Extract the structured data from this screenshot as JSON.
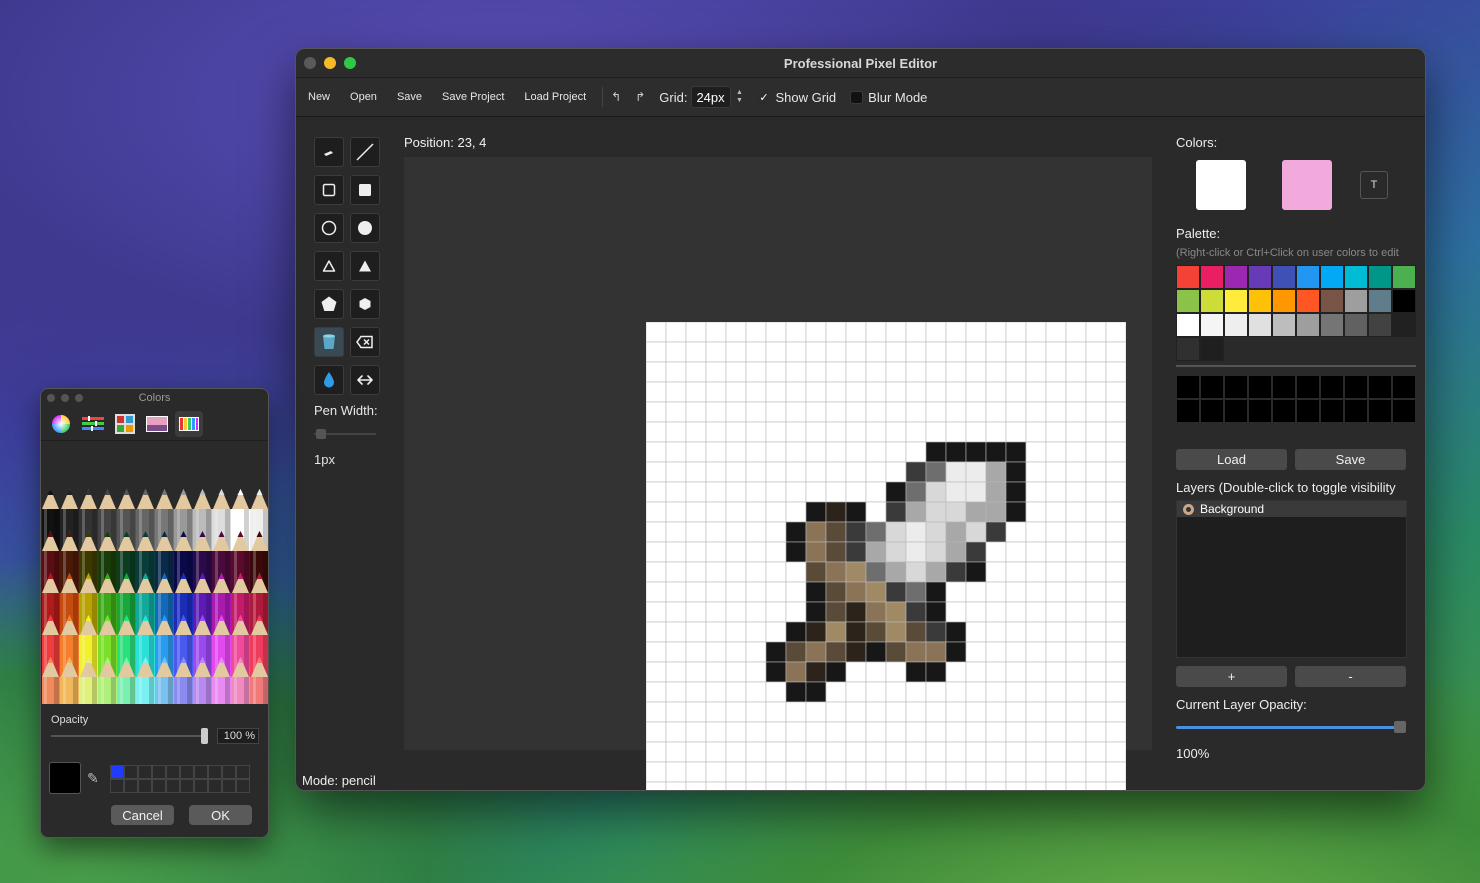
{
  "window": {
    "title": "Professional Pixel Editor"
  },
  "toolbar": {
    "new": "New",
    "open": "Open",
    "save": "Save",
    "save_project": "Save Project",
    "load_project": "Load Project",
    "undo_glyph": "↰",
    "redo_glyph": "↱",
    "grid_label": "Grid:",
    "grid_value": "24px",
    "show_grid_label": "Show Grid",
    "show_grid_checked": true,
    "blur_mode_label": "Blur Mode",
    "blur_mode_checked": false
  },
  "tools": {
    "icons": [
      "pencil-icon",
      "line-icon",
      "rectangle-outline-icon",
      "rectangle-filled-icon",
      "circle-outline-icon",
      "circle-filled-icon",
      "triangle-outline-icon",
      "triangle-filled-icon",
      "pentagon-icon",
      "hexagon-icon",
      "bucket-fill-icon",
      "eraser-icon",
      "eyedropper-drop-icon",
      "move-icon"
    ],
    "pen_width_label": "Pen Width:",
    "pen_width_value": "1px"
  },
  "canvas": {
    "position_text": "Position: 23, 4",
    "grid_size": 24
  },
  "status": {
    "mode_text": "Mode: pencil"
  },
  "right_panel": {
    "colors_label": "Colors:",
    "primary_color": "#ffffff",
    "secondary_color": "#f2a9dc",
    "transparent_button": "T",
    "palette_label": "Palette:",
    "palette_hint": "(Right-click or Ctrl+Click on user colors to edit",
    "palette": [
      "#f44336",
      "#e91e63",
      "#9c27b0",
      "#673ab7",
      "#3f51b5",
      "#2196f3",
      "#03a9f4",
      "#00bcd4",
      "#009688",
      "#4caf50",
      "#8bc34a",
      "#cddc39",
      "#ffeb3b",
      "#ffc107",
      "#ff9800",
      "#ff5722",
      "#795548",
      "#9e9e9e",
      "#607d8b",
      "#000000",
      "#ffffff",
      "#f5f5f5",
      "#eeeeee",
      "#e0e0e0",
      "#bdbdbd",
      "#9e9e9e",
      "#757575",
      "#616161",
      "#424242",
      "#212121",
      "#303030",
      "#1f1f1f"
    ],
    "user_colors_count": 20,
    "load_button": "Load",
    "save_button": "Save",
    "layers_title": "Layers (Double-click to toggle visibility",
    "layers": [
      {
        "name": "Background"
      }
    ],
    "add_layer_button": "+",
    "remove_layer_button": "-",
    "opacity_label": "Current Layer Opacity:",
    "opacity_value": "100%",
    "opacity_fraction": 1.0
  },
  "color_panel": {
    "title": "Colors",
    "tabs": [
      "color-wheel-icon",
      "color-sliders-icon",
      "color-palettes-icon",
      "image-palettes-icon",
      "pencils-icon"
    ],
    "selected_tab": 4,
    "opacity_label": "Opacity",
    "opacity_value": "100 %",
    "current_color": "#000000",
    "cancel_button": "Cancel",
    "ok_button": "OK"
  }
}
